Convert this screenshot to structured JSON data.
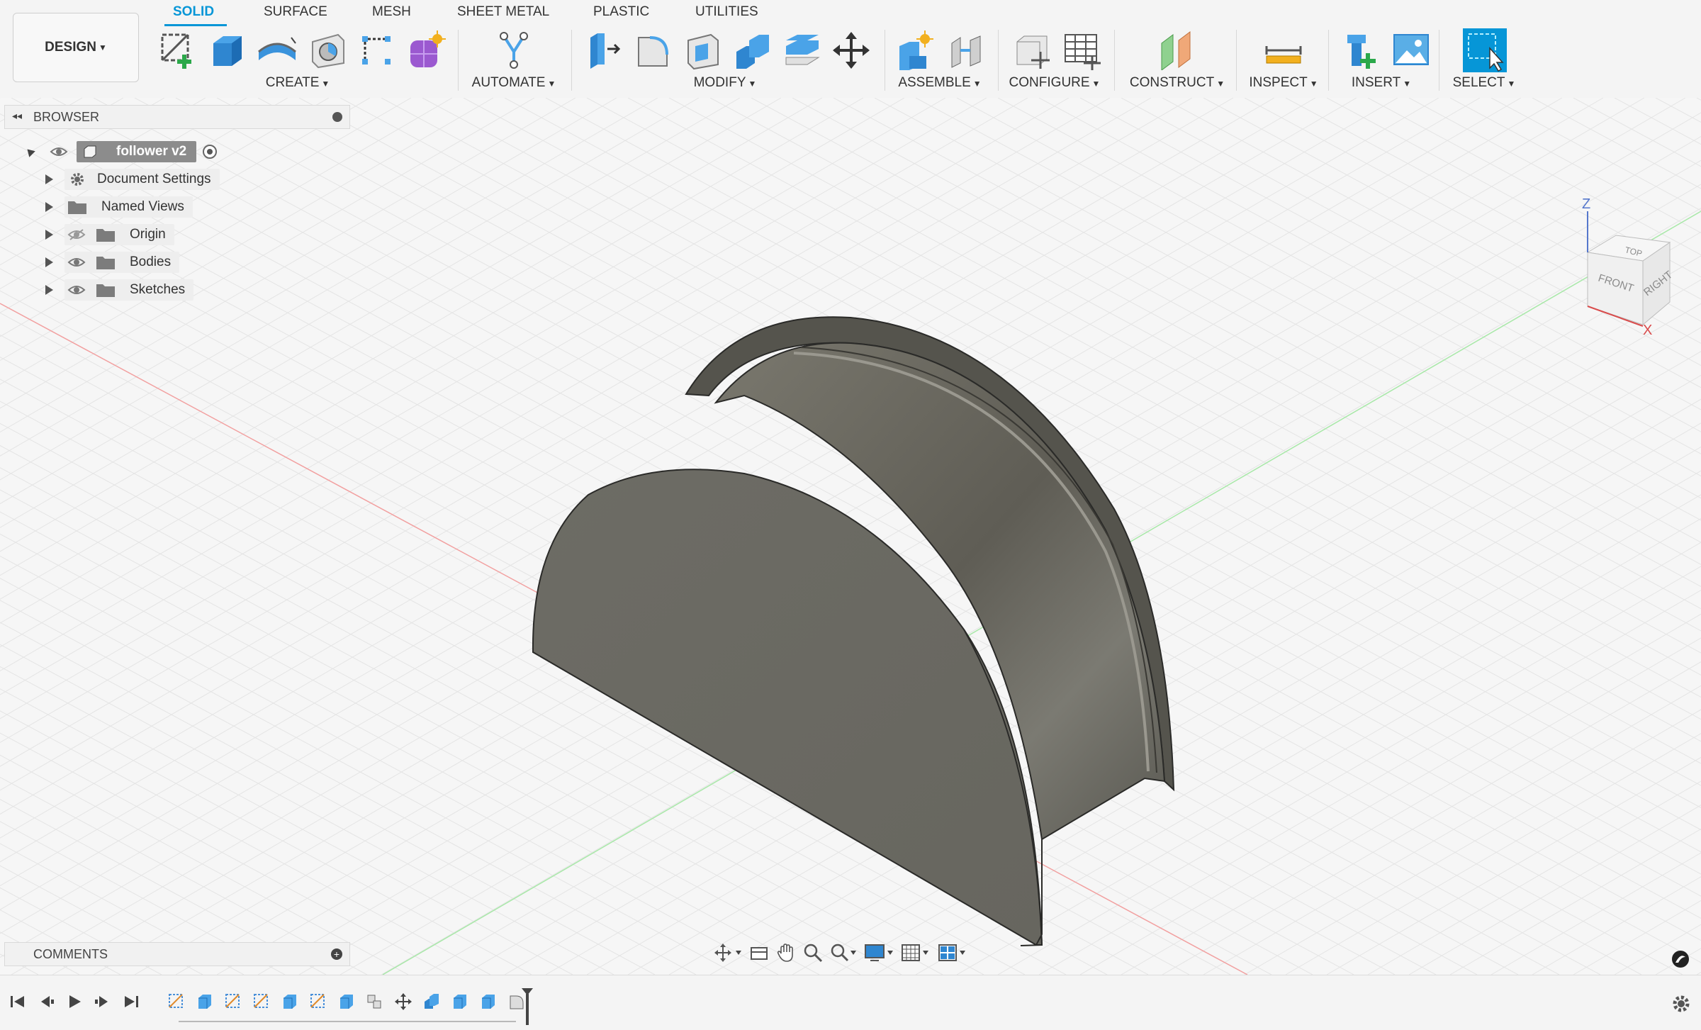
{
  "workspace": {
    "label": "DESIGN"
  },
  "tabs": [
    {
      "label": "SOLID",
      "active": true
    },
    {
      "label": "SURFACE"
    },
    {
      "label": "MESH"
    },
    {
      "label": "SHEET METAL"
    },
    {
      "label": "PLASTIC"
    },
    {
      "label": "UTILITIES"
    }
  ],
  "groups": {
    "create": "CREATE",
    "automate": "AUTOMATE",
    "modify": "MODIFY",
    "assemble": "ASSEMBLE",
    "configure": "CONFIGURE",
    "construct": "CONSTRUCT",
    "inspect": "INSPECT",
    "insert": "INSERT",
    "select": "SELECT"
  },
  "browser": {
    "title": "BROWSER",
    "root": "follower v2",
    "items": [
      {
        "label": "Document Settings",
        "icon": "gear-icon"
      },
      {
        "label": "Named Views",
        "icon": "folder-icon"
      },
      {
        "label": "Origin",
        "icon": "folder-icon",
        "hidden": true
      },
      {
        "label": "Bodies",
        "icon": "folder-icon"
      },
      {
        "label": "Sketches",
        "icon": "folder-icon"
      }
    ]
  },
  "comments": {
    "title": "COMMENTS"
  },
  "viewcube": {
    "top": "TOP",
    "front": "FRONT",
    "right": "RIGHT",
    "axis_z": "Z",
    "axis_x": "X"
  },
  "colors": {
    "accent": "#0696d7",
    "model": "#6b6a62",
    "x_axis": "#e66a6a",
    "y_axis": "#7fd77f"
  }
}
